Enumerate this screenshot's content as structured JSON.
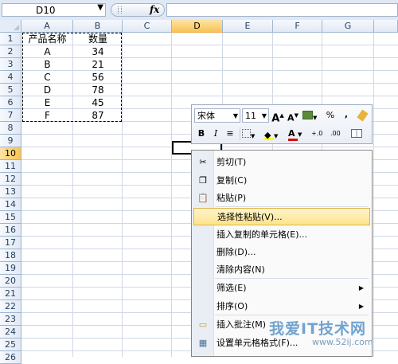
{
  "formula_bar": {
    "name_box": "D10",
    "fx_label": "fx",
    "formula": ""
  },
  "columns": [
    "A",
    "B",
    "C",
    "D",
    "E",
    "F",
    "G"
  ],
  "rows": [
    "1",
    "2",
    "3",
    "4",
    "5",
    "6",
    "7",
    "8",
    "9",
    "10",
    "11",
    "12",
    "13",
    "14",
    "15",
    "16",
    "17",
    "18",
    "19",
    "20",
    "21",
    "22",
    "23",
    "24",
    "25",
    "26"
  ],
  "active_cell": {
    "column": "D",
    "row": "10"
  },
  "sheet": {
    "headers": [
      "产品名称",
      "数量"
    ],
    "data": [
      [
        "A",
        "34"
      ],
      [
        "B",
        "21"
      ],
      [
        "C",
        "56"
      ],
      [
        "D",
        "78"
      ],
      [
        "E",
        "45"
      ],
      [
        "F",
        "87"
      ]
    ]
  },
  "mini_toolbar": {
    "font_name": "宋体",
    "font_size": "11",
    "grow_font": "A",
    "shrink_font": "A",
    "percent": "%",
    "comma": ",",
    "bold": "B",
    "italic": "I",
    "font_color": "A",
    "inc_decimal": "+.0",
    "dec_decimal": ".00"
  },
  "context_menu": {
    "items": [
      {
        "label": "剪切(T)",
        "icon": "scissors-icon"
      },
      {
        "label": "复制(C)",
        "icon": "copy-icon"
      },
      {
        "label": "粘贴(P)",
        "icon": "paste-icon"
      },
      {
        "label": "选择性粘贴(V)...",
        "icon": ""
      },
      {
        "label": "插入复制的单元格(E)...",
        "icon": ""
      },
      {
        "label": "删除(D)...",
        "icon": ""
      },
      {
        "label": "清除内容(N)",
        "icon": ""
      },
      {
        "label": "筛选(E)",
        "icon": "",
        "submenu": true
      },
      {
        "label": "排序(O)",
        "icon": "",
        "submenu": true
      },
      {
        "label": "插入批注(M)",
        "icon": "comment-icon"
      },
      {
        "label": "设置单元格格式(F)...",
        "icon": "format-cells-icon"
      }
    ],
    "highlighted_index": 3
  },
  "watermark": {
    "text": "我爱IT技术网",
    "url": "www.52ij.com"
  },
  "colors": {
    "header_bg": "#e1e9f5",
    "active_header": "#f8c454",
    "menu_highlight": "#fde38a",
    "grid_line": "#d0d7e5"
  }
}
